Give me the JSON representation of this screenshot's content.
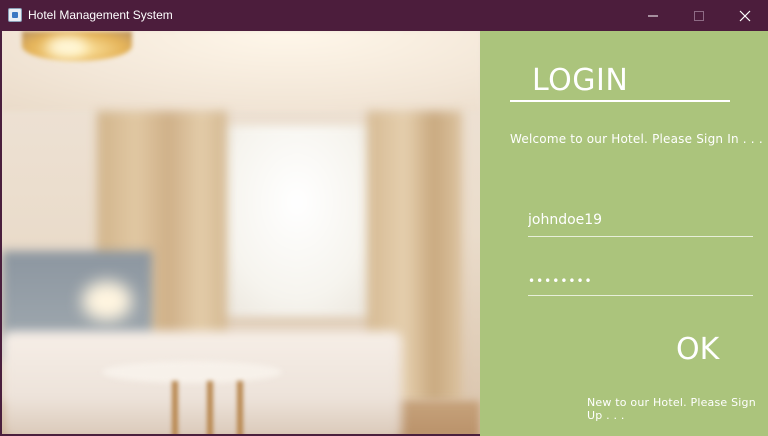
{
  "window": {
    "title": "Hotel Management System",
    "colors": {
      "titlebar": "#4c1d3c",
      "panel": "#abc47c",
      "text": "#ffffff"
    },
    "controls": {
      "minimize_icon": "minimize-icon",
      "maximize_icon": "maximize-icon",
      "close_icon": "close-icon"
    }
  },
  "hero": {
    "image": "hotel-room-photo"
  },
  "login": {
    "heading": "LOGIN",
    "welcome": "Welcome to our Hotel. Please Sign In . . .",
    "username_value": "johndoe19",
    "password_value": "••••••••",
    "ok_label": "OK",
    "signup_link": "New to our Hotel. Please Sign Up . . ."
  }
}
